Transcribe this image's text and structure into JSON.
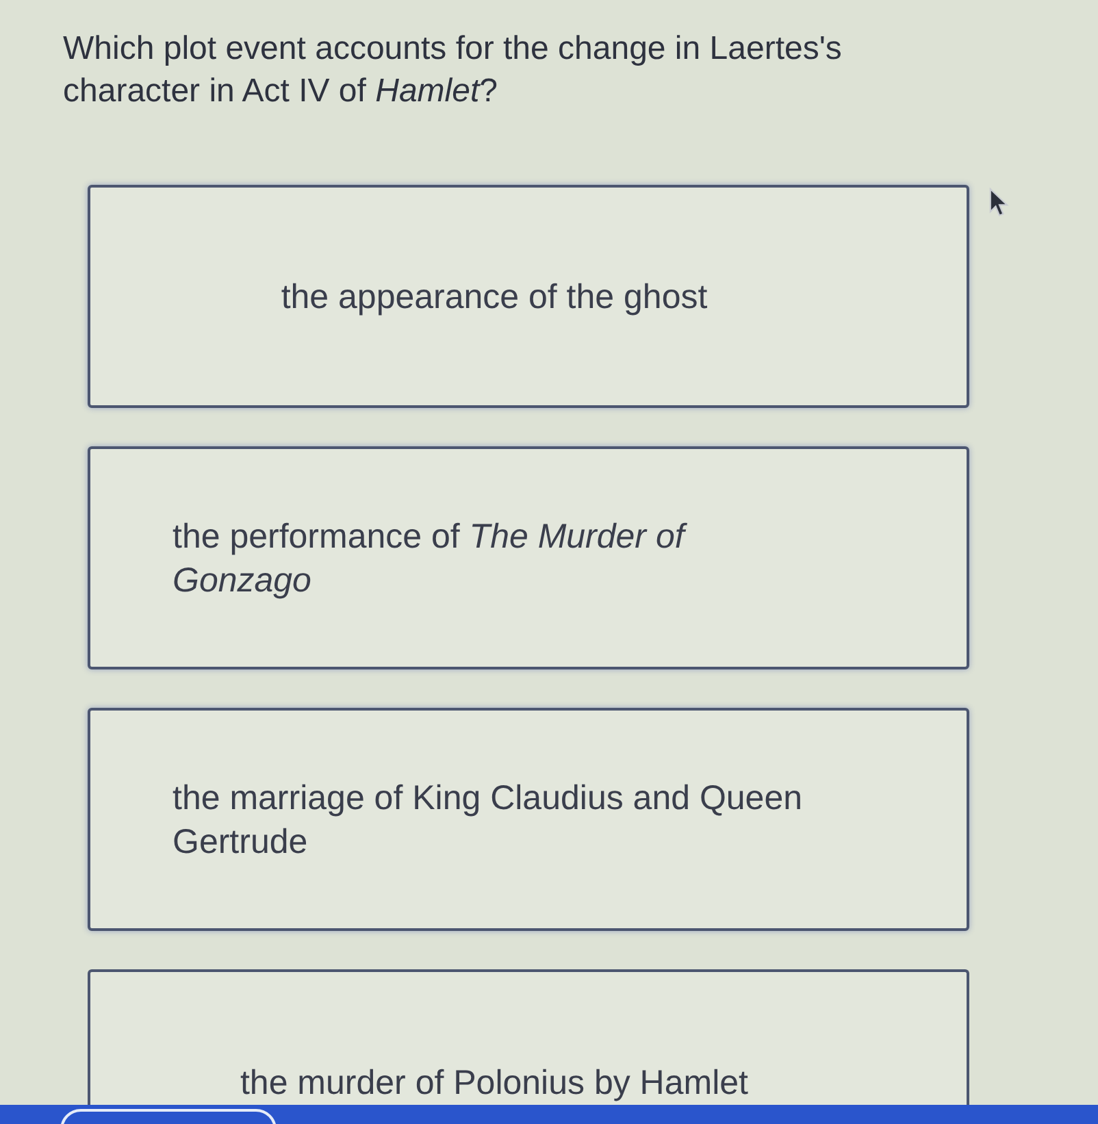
{
  "question": "Which plot event accounts for the change in Laertes's character in Act IV of *Hamlet*?",
  "options": [
    {
      "text": "the appearance of the ghost",
      "selected": false
    },
    {
      "text": "the performance of *The Murder of Gonzago*",
      "selected": false
    },
    {
      "text": "the marriage of King Claudius and Queen Gertrude",
      "selected": false
    },
    {
      "text": "the murder of Polonius by Hamlet",
      "selected": false
    }
  ]
}
